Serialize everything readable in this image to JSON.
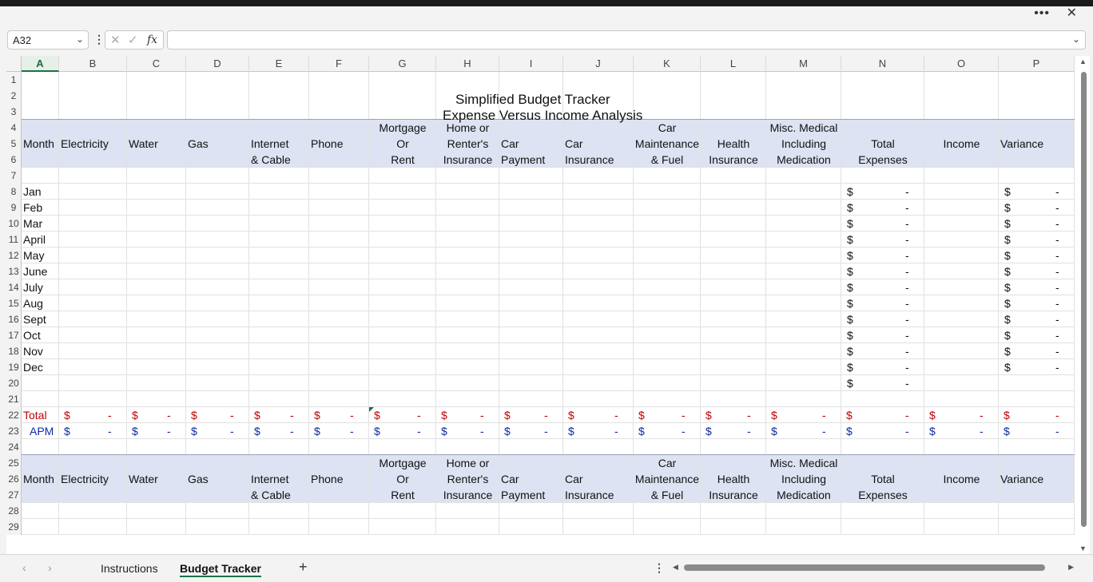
{
  "window": {
    "more_icon": "more-icon",
    "close_icon": "close-icon"
  },
  "formula_bar": {
    "name_box": "A32",
    "formula_value": ""
  },
  "columns": [
    "A",
    "B",
    "C",
    "D",
    "E",
    "F",
    "G",
    "H",
    "I",
    "J",
    "K",
    "L",
    "M",
    "N",
    "O",
    "P"
  ],
  "rows": [
    "1",
    "2",
    "3",
    "4",
    "5",
    "6",
    "7",
    "8",
    "9",
    "10",
    "11",
    "12",
    "13",
    "14",
    "15",
    "16",
    "17",
    "18",
    "19",
    "20",
    "21",
    "22",
    "23",
    "24",
    "25",
    "26",
    "27",
    "28",
    "29"
  ],
  "sheet": {
    "title": "Simplified Budget Tracker",
    "subtitle": "Expense Versus Income Analysis",
    "headers": {
      "month": "Month",
      "electricity": "Electricity",
      "water": "Water",
      "gas": "Gas",
      "internet_1": "Internet",
      "internet_2": "& Cable",
      "phone": "Phone",
      "mortgage_1": "Mortgage",
      "mortgage_2": "Or",
      "mortgage_3": "Rent",
      "home_1": "Home or",
      "home_2": "Renter's",
      "home_3": "Insurance",
      "carpay_1": "Car",
      "carpay_2": "Payment",
      "carins_1": "Car",
      "carins_2": "Insurance",
      "carmaint_1": "Car",
      "carmaint_2": "Maintenance",
      "carmaint_3": "& Fuel",
      "health_1": "Health",
      "health_2": "Insurance",
      "misc_1": "Misc. Medical",
      "misc_2": "Including",
      "misc_3": "Medication",
      "total_1": "Total",
      "total_2": "Expenses",
      "income": "Income",
      "variance": "Variance"
    },
    "months": [
      "Jan",
      "Feb",
      "Mar",
      "April",
      "May",
      "June",
      "July",
      "Aug",
      "Sept",
      "Oct",
      "Nov",
      "Dec"
    ],
    "currency_symbol": "$",
    "dash": "-",
    "total_label": "Total",
    "apm_label": "APM"
  },
  "tabs": {
    "prev_icon": "chevron-left-icon",
    "next_icon": "chevron-right-icon",
    "instructions": "Instructions",
    "budget_tracker": "Budget Tracker",
    "add_icon": "plus-icon"
  },
  "colors": {
    "header_band": "#dde3f2",
    "total_red": "#c00000",
    "apm_blue": "#0d2aa3",
    "accent_green": "#1e7145"
  }
}
